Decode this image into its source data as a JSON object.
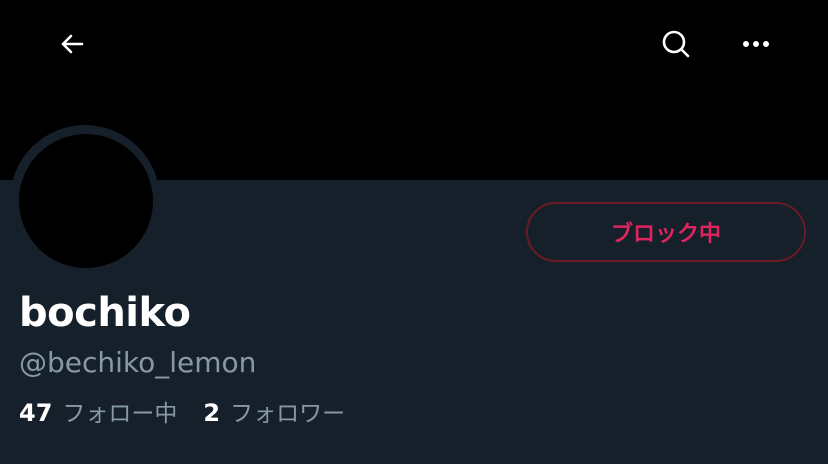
{
  "nav": {
    "back_icon": "back-arrow-icon",
    "search_icon": "search-icon",
    "more_icon": "more-horizontal-icon"
  },
  "profile": {
    "display_name": "bochiko",
    "handle": "@bechiko_lemon",
    "block_button_label": "ブロック中",
    "following_count": "47",
    "following_label": "フォロー中",
    "followers_count": "2",
    "followers_label": "フォロワー"
  },
  "colors": {
    "background": "#15202b",
    "banner": "#000000",
    "blocked_red": "#e0245e",
    "secondary_text": "#8899a6"
  }
}
